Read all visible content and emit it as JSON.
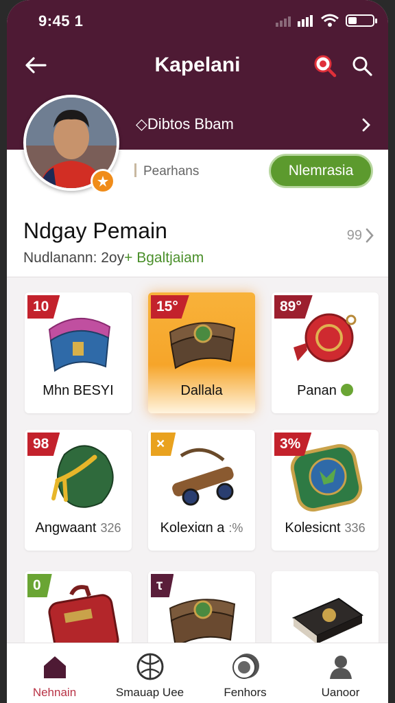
{
  "status_bar": {
    "time": "9:45 1"
  },
  "header": {
    "title": "Kapelani",
    "back_icon": "arrow-left-icon",
    "promo_icon": "magnifier-badge-icon",
    "search_icon": "search-icon"
  },
  "profile": {
    "name": "◇Dibtos Bbam",
    "points_label": "Pearhans",
    "action_label": "Nlemrasia"
  },
  "section": {
    "title": "Ndgay Pemain",
    "subtitle_prefix": "Nudlanann: 2oy",
    "subtitle_highlight": "+ Bgaltjaiam",
    "count": "99"
  },
  "items": [
    {
      "badge": "10",
      "badge_color": "#c3222c",
      "label": "Mhn BESYI",
      "extra": ""
    },
    {
      "badge": "15°",
      "badge_color": "#c3222c",
      "label": "Dallala",
      "extra": ""
    },
    {
      "badge": "89°",
      "badge_color": "#9c1f2e",
      "label": "Panan",
      "extra": ""
    },
    {
      "badge": "98",
      "badge_color": "#c3222c",
      "label": "Angwaant",
      "extra": "326"
    },
    {
      "badge": "×",
      "badge_color": "#e9a21f",
      "label": "Kolexiαn a",
      "extra": ":%"
    },
    {
      "badge": "3%",
      "badge_color": "#c3222c",
      "label": "Kolesicnt",
      "extra": "336"
    },
    {
      "badge": "0",
      "badge_color": "#6aa534",
      "label": "",
      "extra": ""
    },
    {
      "badge": "τ",
      "badge_color": "#5a1e3a",
      "label": "",
      "extra": ""
    },
    {
      "badge": "",
      "badge_color": "#ffffff",
      "label": "",
      "extra": ""
    }
  ],
  "bottom_nav": [
    {
      "label": "Nehnain",
      "icon": "home-icon",
      "active": true
    },
    {
      "label": "Smauap Uee",
      "icon": "ball-icon",
      "active": false
    },
    {
      "label": "Fenhors",
      "icon": "coin-icon",
      "active": false
    },
    {
      "label": "Uanoor",
      "icon": "profile-icon",
      "active": false
    }
  ],
  "colors": {
    "header": "#4e1a34",
    "accent_green": "#5c9a2e",
    "active_tab": "#b83245"
  }
}
